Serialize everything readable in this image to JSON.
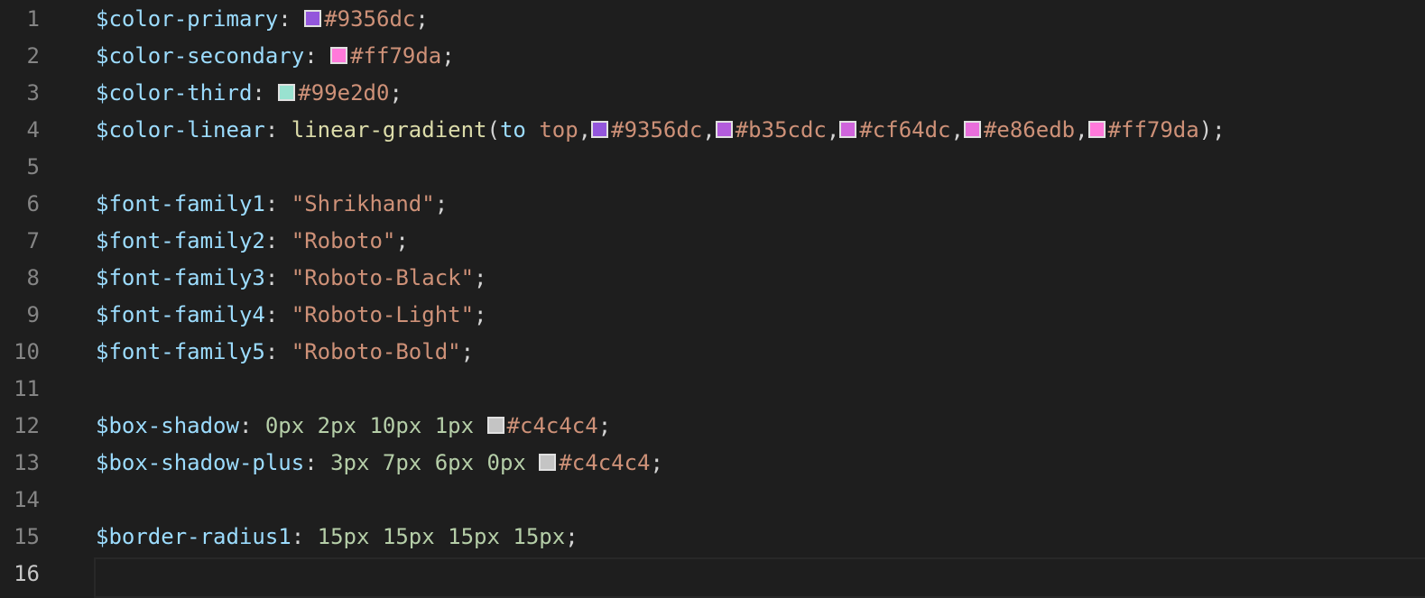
{
  "editor": {
    "lines": [
      {
        "n": "1",
        "tokens": [
          {
            "t": "$color-primary",
            "c": "var"
          },
          {
            "t": ": ",
            "c": "punc"
          },
          {
            "sw": "#9356dc",
            "name": "color-swatch-icon"
          },
          {
            "t": "#9356dc",
            "c": "hex"
          },
          {
            "t": ";",
            "c": "punc"
          }
        ]
      },
      {
        "n": "2",
        "tokens": [
          {
            "t": "$color-secondary",
            "c": "var"
          },
          {
            "t": ": ",
            "c": "punc"
          },
          {
            "sw": "#ff79da",
            "name": "color-swatch-icon"
          },
          {
            "t": "#ff79da",
            "c": "hex"
          },
          {
            "t": ";",
            "c": "punc"
          }
        ]
      },
      {
        "n": "3",
        "tokens": [
          {
            "t": "$color-third",
            "c": "var"
          },
          {
            "t": ": ",
            "c": "punc"
          },
          {
            "sw": "#99e2d0",
            "name": "color-swatch-icon"
          },
          {
            "t": "#99e2d0",
            "c": "hex"
          },
          {
            "t": ";",
            "c": "punc"
          }
        ]
      },
      {
        "n": "4",
        "tokens": [
          {
            "t": "$color-linear",
            "c": "var"
          },
          {
            "t": ": ",
            "c": "punc"
          },
          {
            "t": "linear-gradient",
            "c": "fn"
          },
          {
            "t": "(",
            "c": "punc"
          },
          {
            "t": "to",
            "c": "var"
          },
          {
            "t": " ",
            "c": "punc"
          },
          {
            "t": "top",
            "c": "kw"
          },
          {
            "t": ",",
            "c": "punc"
          },
          {
            "sw": "#9356dc",
            "name": "color-swatch-icon"
          },
          {
            "t": "#9356dc",
            "c": "hex"
          },
          {
            "t": ",",
            "c": "punc"
          },
          {
            "sw": "#b35cdc",
            "name": "color-swatch-icon"
          },
          {
            "t": "#b35cdc",
            "c": "hex"
          },
          {
            "t": ",",
            "c": "punc"
          },
          {
            "sw": "#cf64dc",
            "name": "color-swatch-icon"
          },
          {
            "t": "#cf64dc",
            "c": "hex"
          },
          {
            "t": ",",
            "c": "punc"
          },
          {
            "sw": "#e86edb",
            "name": "color-swatch-icon"
          },
          {
            "t": "#e86edb",
            "c": "hex"
          },
          {
            "t": ",",
            "c": "punc"
          },
          {
            "sw": "#ff79da",
            "name": "color-swatch-icon"
          },
          {
            "t": "#ff79da",
            "c": "hex"
          },
          {
            "t": ");",
            "c": "punc"
          }
        ]
      },
      {
        "n": "5",
        "tokens": []
      },
      {
        "n": "6",
        "tokens": [
          {
            "t": "$font-family1",
            "c": "var"
          },
          {
            "t": ": ",
            "c": "punc"
          },
          {
            "t": "\"Shrikhand\"",
            "c": "str"
          },
          {
            "t": ";",
            "c": "punc"
          }
        ]
      },
      {
        "n": "7",
        "tokens": [
          {
            "t": "$font-family2",
            "c": "var"
          },
          {
            "t": ": ",
            "c": "punc"
          },
          {
            "t": "\"Roboto\"",
            "c": "str"
          },
          {
            "t": ";",
            "c": "punc"
          }
        ]
      },
      {
        "n": "8",
        "tokens": [
          {
            "t": "$font-family3",
            "c": "var"
          },
          {
            "t": ": ",
            "c": "punc"
          },
          {
            "t": "\"Roboto-Black\"",
            "c": "str"
          },
          {
            "t": ";",
            "c": "punc"
          }
        ]
      },
      {
        "n": "9",
        "tokens": [
          {
            "t": "$font-family4",
            "c": "var"
          },
          {
            "t": ": ",
            "c": "punc"
          },
          {
            "t": "\"Roboto-Light\"",
            "c": "str"
          },
          {
            "t": ";",
            "c": "punc"
          }
        ]
      },
      {
        "n": "10",
        "tokens": [
          {
            "t": "$font-family5",
            "c": "var"
          },
          {
            "t": ": ",
            "c": "punc"
          },
          {
            "t": "\"Roboto-Bold\"",
            "c": "str"
          },
          {
            "t": ";",
            "c": "punc"
          }
        ]
      },
      {
        "n": "11",
        "tokens": []
      },
      {
        "n": "12",
        "tokens": [
          {
            "t": "$box-shadow",
            "c": "var"
          },
          {
            "t": ": ",
            "c": "punc"
          },
          {
            "t": "0px",
            "c": "num"
          },
          {
            "t": " ",
            "c": "punc"
          },
          {
            "t": "2px",
            "c": "num"
          },
          {
            "t": " ",
            "c": "punc"
          },
          {
            "t": "10px",
            "c": "num"
          },
          {
            "t": " ",
            "c": "punc"
          },
          {
            "t": "1px",
            "c": "num"
          },
          {
            "t": " ",
            "c": "punc"
          },
          {
            "sw": "#c4c4c4",
            "name": "color-swatch-icon"
          },
          {
            "t": "#c4c4c4",
            "c": "hex"
          },
          {
            "t": ";",
            "c": "punc"
          }
        ]
      },
      {
        "n": "13",
        "tokens": [
          {
            "t": "$box-shadow-plus",
            "c": "var"
          },
          {
            "t": ": ",
            "c": "punc"
          },
          {
            "t": "3px",
            "c": "num"
          },
          {
            "t": " ",
            "c": "punc"
          },
          {
            "t": "7px",
            "c": "num"
          },
          {
            "t": " ",
            "c": "punc"
          },
          {
            "t": "6px",
            "c": "num"
          },
          {
            "t": " ",
            "c": "punc"
          },
          {
            "t": "0px",
            "c": "num"
          },
          {
            "t": " ",
            "c": "punc"
          },
          {
            "sw": "#c4c4c4",
            "name": "color-swatch-icon"
          },
          {
            "t": "#c4c4c4",
            "c": "hex"
          },
          {
            "t": ";",
            "c": "punc"
          }
        ]
      },
      {
        "n": "14",
        "tokens": []
      },
      {
        "n": "15",
        "tokens": [
          {
            "t": "$border-radius1",
            "c": "var"
          },
          {
            "t": ": ",
            "c": "punc"
          },
          {
            "t": "15px",
            "c": "num"
          },
          {
            "t": " ",
            "c": "punc"
          },
          {
            "t": "15px",
            "c": "num"
          },
          {
            "t": " ",
            "c": "punc"
          },
          {
            "t": "15px",
            "c": "num"
          },
          {
            "t": " ",
            "c": "punc"
          },
          {
            "t": "15px",
            "c": "num"
          },
          {
            "t": ";",
            "c": "punc"
          }
        ]
      },
      {
        "n": "16",
        "tokens": [],
        "current": true
      }
    ]
  }
}
